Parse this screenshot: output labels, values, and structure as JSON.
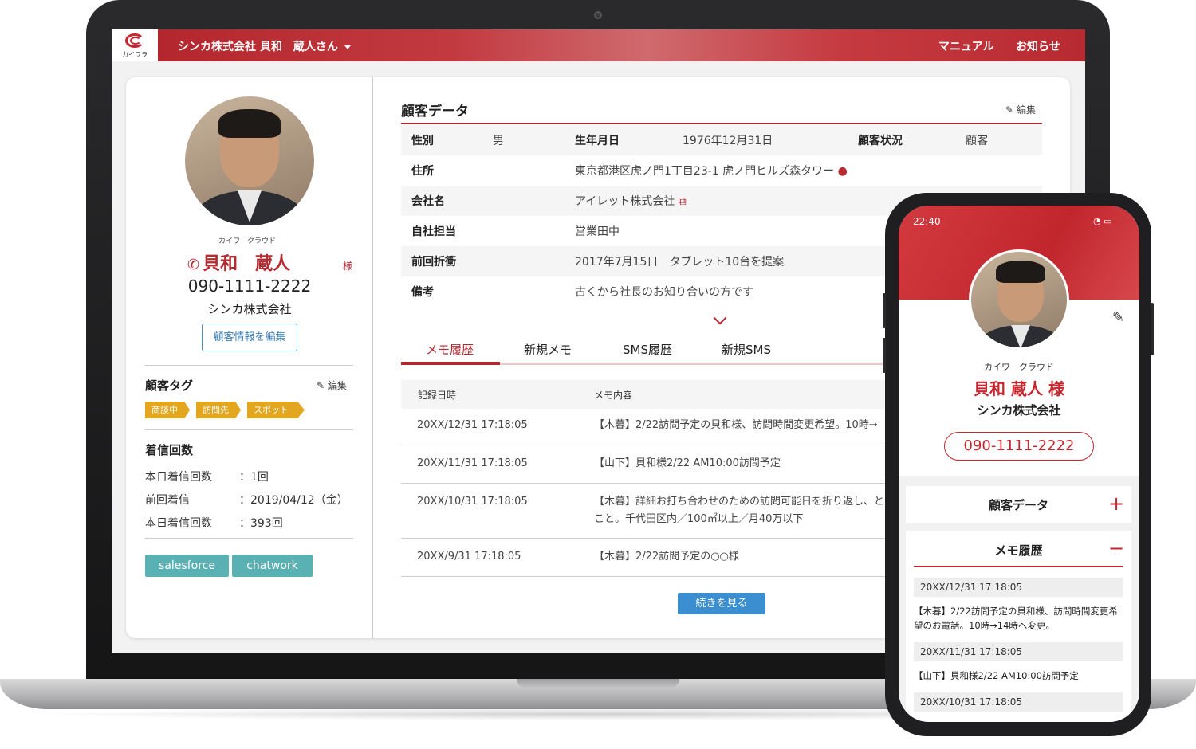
{
  "header": {
    "logo_text": "カイワラ",
    "user": "シンカ株式会社 貝和　蔵人さん",
    "links": [
      "マニュアル",
      "お知らせ"
    ]
  },
  "profile": {
    "kana": "カイワ　クラウド",
    "name": "貝和　蔵人",
    "honorific": "様",
    "phone": "090-1111-2222",
    "company": "シンカ株式会社",
    "edit_button": "顧客情報を編集"
  },
  "tags_section": {
    "title": "顧客タグ",
    "edit": "編集",
    "tags": [
      "商談中",
      "訪問先",
      "スポット"
    ]
  },
  "calls": {
    "title": "着信回数",
    "rows": [
      {
        "label": "本日着信回数",
        "value": "：1回"
      },
      {
        "label": "前回着信",
        "value": "：2019/04/12（金）"
      },
      {
        "label": "本日着信回数",
        "value": "：393回"
      }
    ]
  },
  "integrations": [
    "salesforce",
    "chatwork"
  ],
  "customer_data": {
    "title": "顧客データ",
    "edit": "編集",
    "gender_label": "性別",
    "gender": "男",
    "birth_label": "生年月日",
    "birth": "1976年12月31日",
    "status_label": "顧客状況",
    "status": "顧客",
    "address_label": "住所",
    "address": "東京都港区虎ノ門1丁目23-1 虎ノ門ヒルズ森タワー",
    "company_label": "会社名",
    "company": "アイレット株式会社",
    "owner_label": "自社担当",
    "owner": "営業田中",
    "last_label": "前回折衝",
    "last": "2017年7月15日　タブレット10台を提案",
    "note_label": "備考",
    "note": "古くから社長のお知り合いの方です"
  },
  "tabs": [
    "メモ履歴",
    "新規メモ",
    "SMS履歴",
    "新規SMS"
  ],
  "memo_table": {
    "headers": [
      "記録日時",
      "メモ内容"
    ],
    "rows": [
      {
        "date": "20XX/12/31 17:18:05",
        "memo": "【木暮】2/22訪問予定の貝和様、訪問時間変更希望。10時→"
      },
      {
        "date": "20XX/11/31 17:18:05",
        "memo": "【山下】貝和様2/22 AM10:00訪問予定"
      },
      {
        "date": "20XX/10/31 17:18:05",
        "memo": "【木暮】詳細お打ち合わせのための訪問可能日を折り返し、とのこと。千代田区内／100㎡以上／月40万以下"
      },
      {
        "date": "20XX/9/31 17:18:05",
        "memo": "【木暮】2/22訪問予定の○○様"
      }
    ],
    "more_button": "続きを見る"
  },
  "mobile": {
    "time": "22:40",
    "kana": "カイワ　クラウド",
    "name": "貝和 蔵人 様",
    "company": "シンカ株式会社",
    "phone": "090-1111-2222",
    "customer_data": "顧客データ",
    "memo_title": "メモ履歴",
    "memos": [
      {
        "date": "20XX/12/31 17:18:05",
        "text": "【木暮】2/22訪問予定の貝和様、訪問時間変更希望のお電話。10時→14時へ変更。"
      },
      {
        "date": "20XX/11/31 17:18:05",
        "text": "【山下】貝和様2/22 AM10:00訪問予定"
      },
      {
        "date": "20XX/10/31 17:18:05",
        "text": ""
      }
    ]
  },
  "colors": {
    "brand_red": "#b52a31",
    "teal": "#5ab1b3",
    "tag_orange": "#e3a61f",
    "link_blue": "#3b8fd0"
  }
}
